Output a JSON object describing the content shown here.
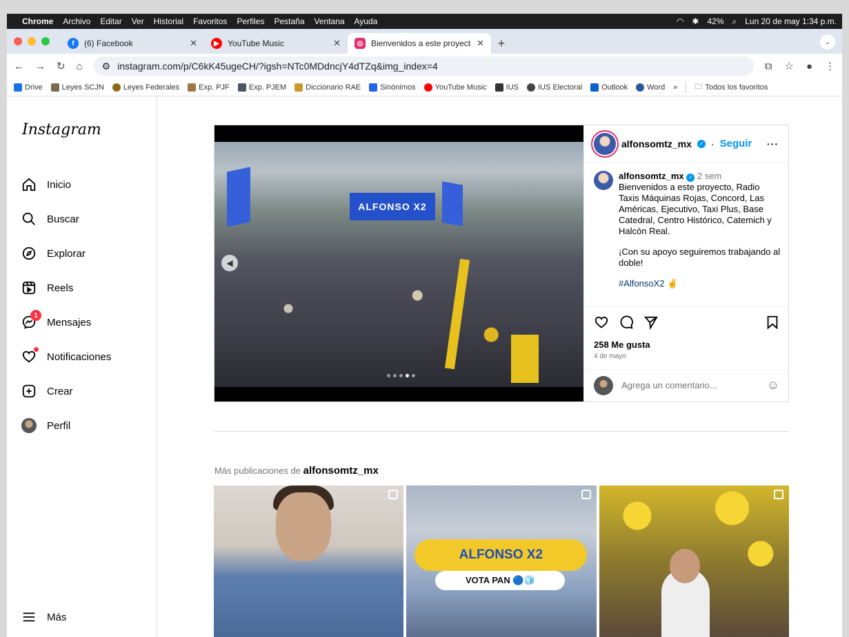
{
  "menubar": {
    "apple": "",
    "app": "Chrome",
    "items": [
      "Archivo",
      "Editar",
      "Ver",
      "Historial",
      "Favoritos",
      "Perfiles",
      "Pestaña",
      "Ventana",
      "Ayuda"
    ],
    "battery": "42%",
    "datetime": "Lun 20 de may 1:34 p.m."
  },
  "tabs": [
    {
      "title": "(6) Facebook",
      "icon": "facebook-icon",
      "color": "#1877f2"
    },
    {
      "title": "YouTube Music",
      "icon": "youtube-music-icon",
      "color": "#ff0000"
    },
    {
      "title": "Bienvenidos a este proyecto,",
      "icon": "instagram-icon",
      "color": "#e1306c"
    }
  ],
  "address": {
    "url": "instagram.com/p/C6kK45ugeCH/?igsh=NTc0MDdncjY4dTZq&img_index=4"
  },
  "bookmarks": [
    {
      "label": "Drive",
      "color": "#1a73e8"
    },
    {
      "label": "Leyes SCJN",
      "color": "#7a6a52"
    },
    {
      "label": "Leyes Federales",
      "color": "#8b6b1b"
    },
    {
      "label": "Exp. PJF",
      "color": "#9b7a44"
    },
    {
      "label": "Exp. PJEM",
      "color": "#4b5563"
    },
    {
      "label": "Diccionario RAE",
      "color": "#c99a2e"
    },
    {
      "label": "Sinónimos",
      "color": "#2563eb"
    },
    {
      "label": "YouTube Music",
      "color": "#ff0000"
    },
    {
      "label": "IUS",
      "color": "#333333"
    },
    {
      "label": "IUS Electoral",
      "color": "#444444"
    },
    {
      "label": "Outlook",
      "color": "#0a64c8"
    },
    {
      "label": "Word",
      "color": "#2b579a"
    }
  ],
  "bookmarks_overflow": "»",
  "bookmarks_all": "Todos los favoritos",
  "instagram": {
    "logo": "Instagram",
    "nav": [
      {
        "label": "Inicio",
        "icon": "home-icon"
      },
      {
        "label": "Buscar",
        "icon": "search-icon"
      },
      {
        "label": "Explorar",
        "icon": "compass-icon"
      },
      {
        "label": "Reels",
        "icon": "reels-icon"
      },
      {
        "label": "Mensajes",
        "icon": "messenger-icon",
        "badge": "1"
      },
      {
        "label": "Notificaciones",
        "icon": "heart-icon"
      },
      {
        "label": "Crear",
        "icon": "plus-square-icon"
      },
      {
        "label": "Perfil",
        "icon": "profile-avatar"
      }
    ],
    "more": "Más"
  },
  "post": {
    "banner_text": "ALFONSO X2",
    "username": "alfonsomtz_mx",
    "separator": "·",
    "follow": "Seguir",
    "time": "2 sem",
    "caption_1": "Bienvenidos a este proyecto, Radio Taxis Máquinas Rojas, Concord, Las Américas, Ejecutivo, Taxi Plus, Base Catedral, Centro Histórico, Catemich y Halcón Real.",
    "caption_2": "¡Con su apoyo seguiremos trabajando al doble!",
    "hashtag": "#AlfonsoX2 ✌",
    "likes": "258 Me gusta",
    "date": "4 de mayo",
    "comment_placeholder": "Agrega un comentario...",
    "carousel_total": 5,
    "carousel_index": 4
  },
  "more_posts": {
    "prefix": "Más publicaciones de",
    "username": "alfonsomtz_mx",
    "thumb2_title": "ALFONSO X2",
    "thumb2_sub": "VOTA PAN 🔵🧊"
  }
}
